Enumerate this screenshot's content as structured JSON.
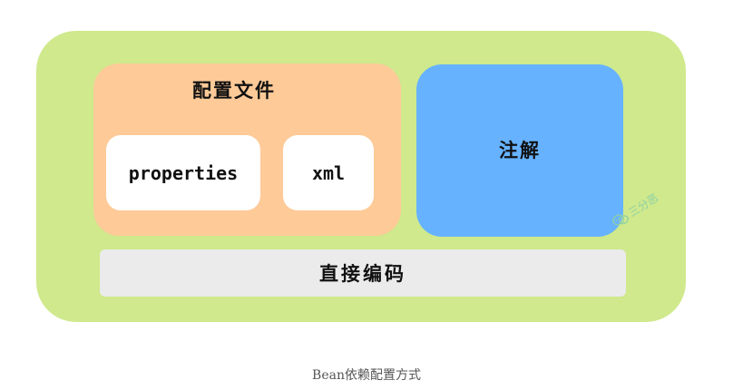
{
  "diagram": {
    "config_group": {
      "title": "配置文件",
      "items": [
        "properties",
        "xml"
      ]
    },
    "annotation": "注解",
    "direct_code": "直接编码",
    "watermark": "三分恶"
  },
  "caption": "Bean依赖配置方式",
  "colors": {
    "outer": "#cfe98c",
    "config": "#fdca98",
    "chip": "#ffffff",
    "annotation": "#66b2ff",
    "code_bar": "#ebebeb",
    "watermark": "#8fd0a4"
  }
}
